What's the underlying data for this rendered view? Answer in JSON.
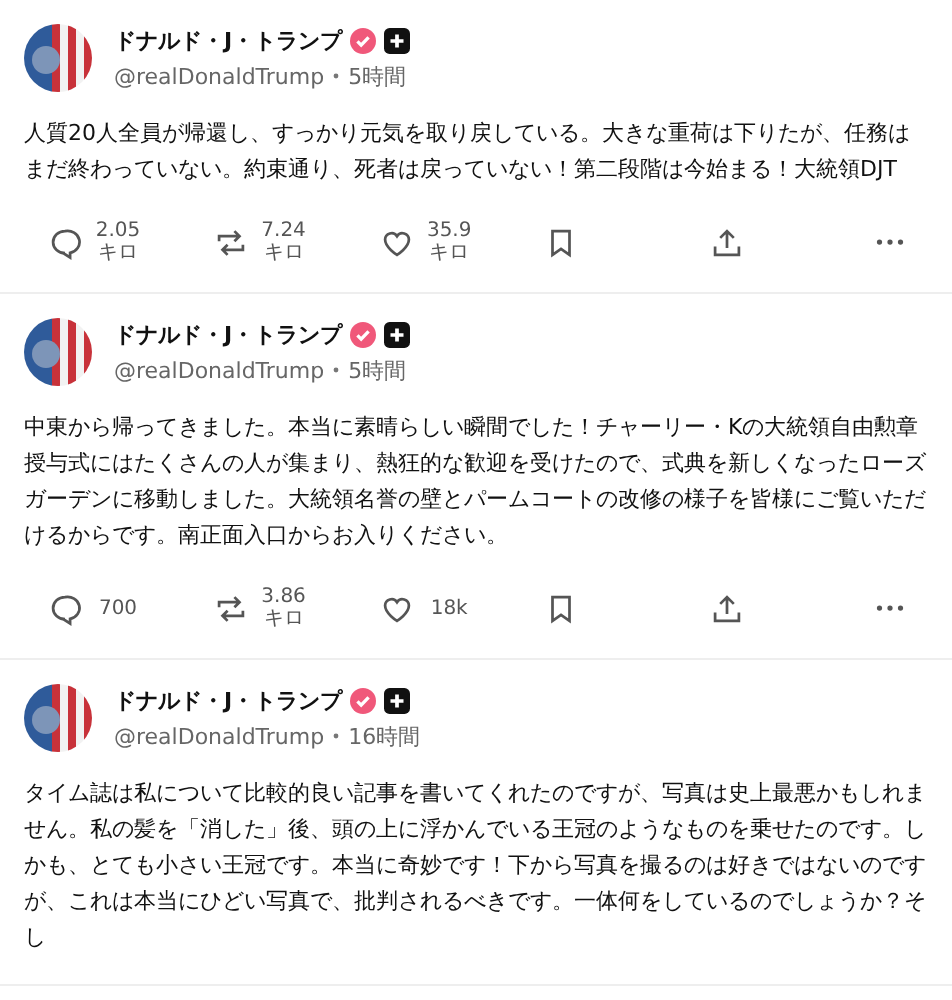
{
  "posts": [
    {
      "name": "ドナルド・J・トランプ",
      "handle": "@realDonaldTrump",
      "time": "5時間",
      "text": "人質20人全員が帰還し、すっかり元気を取り戻している。大きな重荷は下りたが、任務はまだ終わっていない。約束通り、死者は戻っていない！第二段階は今始まる！大統領DJT",
      "replies": "2.05キロ",
      "reposts": "7.24キロ",
      "likes": "35.9キロ"
    },
    {
      "name": "ドナルド・J・トランプ",
      "handle": "@realDonaldTrump",
      "time": "5時間",
      "text": "中東から帰ってきました。本当に素晴らしい瞬間でした！チャーリー・Kの大統領自由勲章授与式にはたくさんの人が集まり、熱狂的な歓迎を受けたので、式典を新しくなったローズガーデンに移動しました。大統領名誉の壁とパームコートの改修の様子を皆様にご覧いただけるからです。南正面入口からお入りください。",
      "replies": "700",
      "reposts": "3.86キロ",
      "likes": "18k"
    },
    {
      "name": "ドナルド・J・トランプ",
      "handle": "@realDonaldTrump",
      "time": "16時間",
      "text": "タイム誌は私について比較的良い記事を書いてくれたのですが、写真は史上最悪かもしれません。私の髪を「消した」後、頭の上に浮かんでいる王冠のようなものを乗せたのです。しかも、とても小さい王冠です。本当に奇妙です！下から写真を撮るのは好きではないのですが、これは本当にひどい写真で、批判されるべきです。一体何をしているのでしょうか？そし"
    }
  ]
}
